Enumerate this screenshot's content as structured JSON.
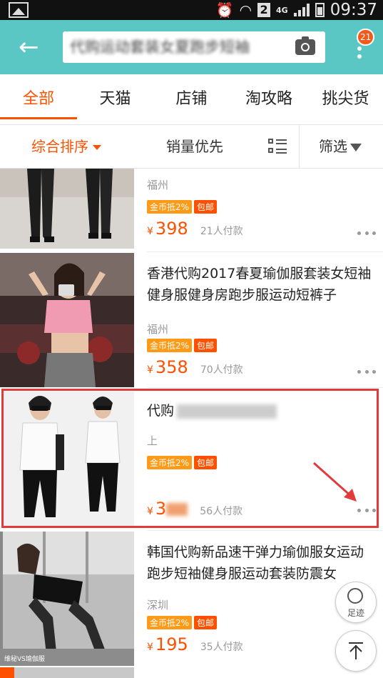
{
  "status_bar": {
    "sim_slot": "2",
    "network": "4G",
    "time": "09:37"
  },
  "header": {
    "search_value": "代购运动套装女夏跑步短袖",
    "notification_count": "21"
  },
  "tabs": [
    {
      "label": "全部",
      "active": true
    },
    {
      "label": "天猫",
      "active": false
    },
    {
      "label": "店铺",
      "active": false
    },
    {
      "label": "淘攻略",
      "active": false
    },
    {
      "label": "挑尖货",
      "active": false
    }
  ],
  "sort": {
    "default": "综合排序",
    "sales": "销量优先",
    "filter": "筛选"
  },
  "products": [
    {
      "title": "",
      "location": "福州",
      "tag_coin": "金币抵2%",
      "tag_shipping": "包邮",
      "currency": "¥",
      "price": "398",
      "sold": "21人付款"
    },
    {
      "title": "香港代购2017春夏瑜伽服套装女短袖健身服健身房跑步服运动短裤子",
      "location": "福州",
      "tag_coin": "金币抵2%",
      "tag_shipping": "包邮",
      "currency": "¥",
      "price": "358",
      "sold": "70人付款"
    },
    {
      "title": "代购",
      "location": "上",
      "tag_coin": "金币抵2%",
      "tag_shipping": "包邮",
      "currency": "¥",
      "price": "3",
      "sold": "56人付款"
    },
    {
      "title": "韩国代购新品速干弹力瑜伽服女运动跑步短袖健身服运动套装防震女",
      "location": "深圳",
      "tag_coin": "金币抵2%",
      "tag_shipping": "包邮",
      "currency": "¥",
      "price": "195",
      "sold": "35人付款",
      "image_caption": "维秘VS瑜伽服"
    }
  ],
  "floating": {
    "footprint_label": "足迹"
  },
  "colors": {
    "accent": "#ff5000",
    "header_bg": "#5ac7c4",
    "highlight": "#e23b3b"
  }
}
